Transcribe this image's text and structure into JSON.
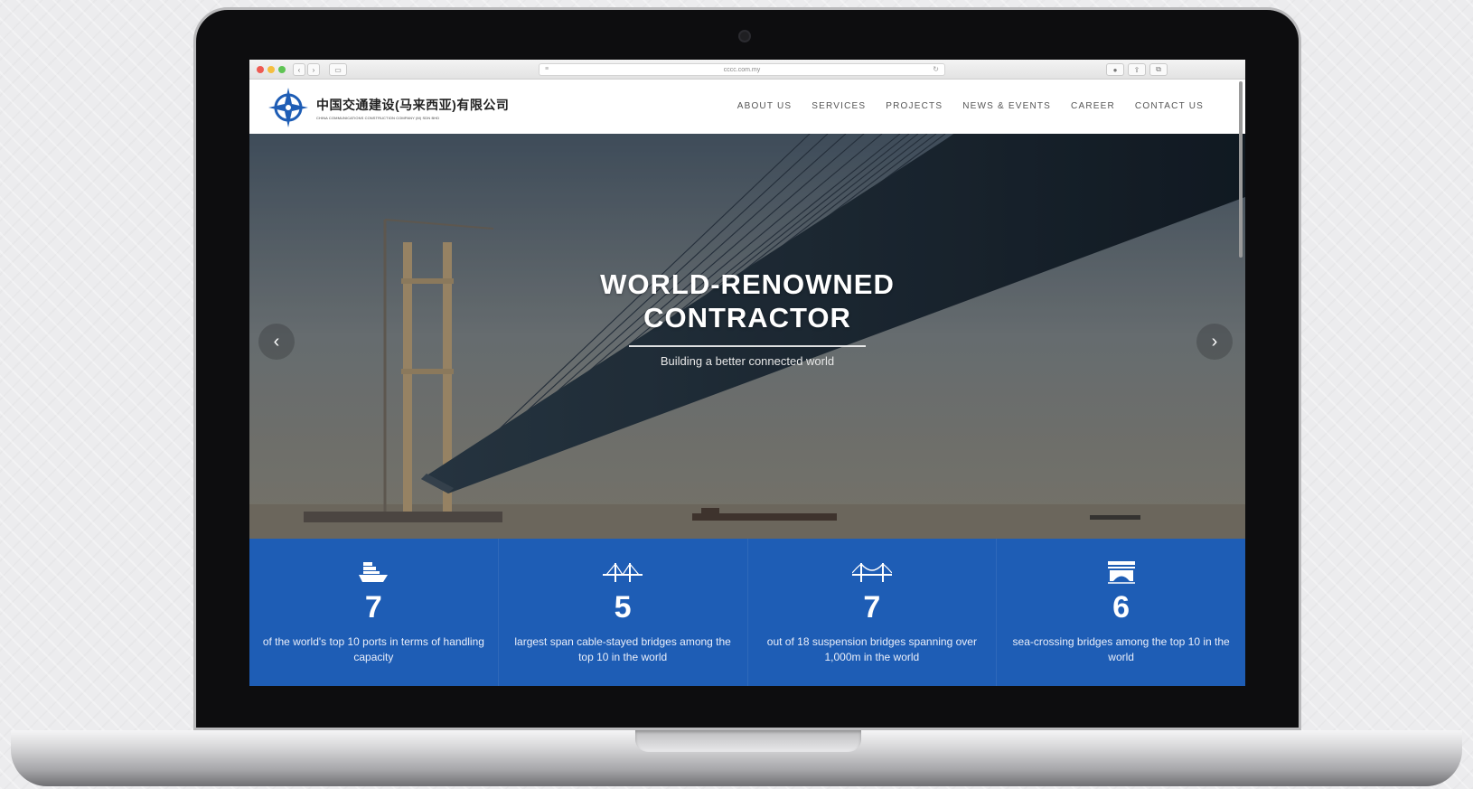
{
  "browser": {
    "url": "cccc.com.my"
  },
  "site": {
    "logo_cn": "中国交通建设(马来西亚)有限公司",
    "logo_en": "CHINA COMMUNICATIONS CONSTRUCTION COMPANY (M) SDN BHD",
    "menu": [
      "ABOUT US",
      "SERVICES",
      "PROJECTS",
      "NEWS & EVENTS",
      "CAREER",
      "CONTACT US"
    ]
  },
  "hero": {
    "title_line1": "WORLD-RENOWNED",
    "title_line2": "CONTRACTOR",
    "subtitle": "Building a better connected world",
    "prev_arrow": "‹",
    "next_arrow": "›"
  },
  "stats": [
    {
      "icon": "ship-icon",
      "number": "7",
      "text": "of the world's top 10 ports in terms of handling capacity"
    },
    {
      "icon": "cable-bridge-icon",
      "number": "5",
      "text": "largest span cable-stayed bridges among the top 10 in the world"
    },
    {
      "icon": "suspension-bridge-icon",
      "number": "7",
      "text": "out of 18 suspension bridges spanning over 1,000m in the world"
    },
    {
      "icon": "sea-bridge-icon",
      "number": "6",
      "text": "sea-crossing bridges among the top 10 in the world"
    }
  ],
  "colors": {
    "stats_bg": "#1e5db5",
    "logo_blue": "#1e5db5"
  }
}
